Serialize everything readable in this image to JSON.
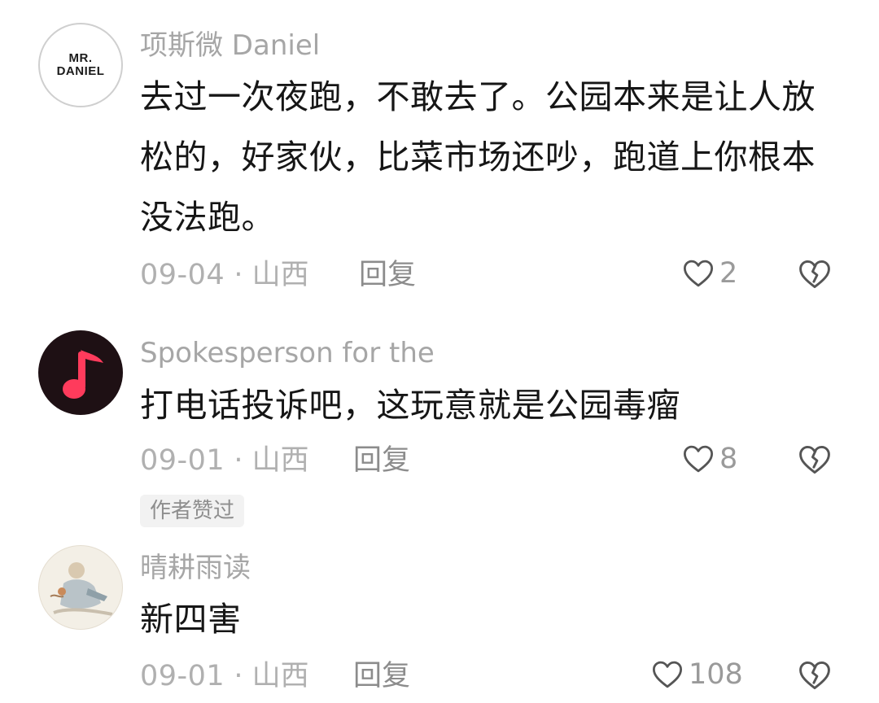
{
  "comments": [
    {
      "username": "项斯微 Daniel",
      "avatar_text": [
        "MR.",
        "DANIEL"
      ],
      "text_lines": [
        "去过一次夜跑，不敢去了。公园本来是让人放",
        "松的，好家伙，比菜市场还吵，跑道上你根本",
        "没法跑。"
      ],
      "date": "09-04",
      "location": "山西",
      "reply_label": "回复",
      "likes": "2"
    },
    {
      "username": "Spokesperson for the",
      "text_lines": [
        "打电话投诉吧，这玩意就是公园毒瘤"
      ],
      "date": "09-01",
      "location": "山西",
      "reply_label": "回复",
      "likes": "8",
      "badge": "作者赞过"
    },
    {
      "username": "晴耕雨读",
      "text_lines": [
        "新四害"
      ],
      "date": "09-01",
      "location": "山西",
      "reply_label": "回复",
      "likes": "108"
    }
  ],
  "meta_separator": "·",
  "icons": {
    "like": "heart-outline-icon",
    "dislike": "broken-heart-icon",
    "avatar2": "music-note-icon"
  },
  "colors": {
    "music_note": "#ff3b5c",
    "muted_text": "#a6a6a6"
  }
}
